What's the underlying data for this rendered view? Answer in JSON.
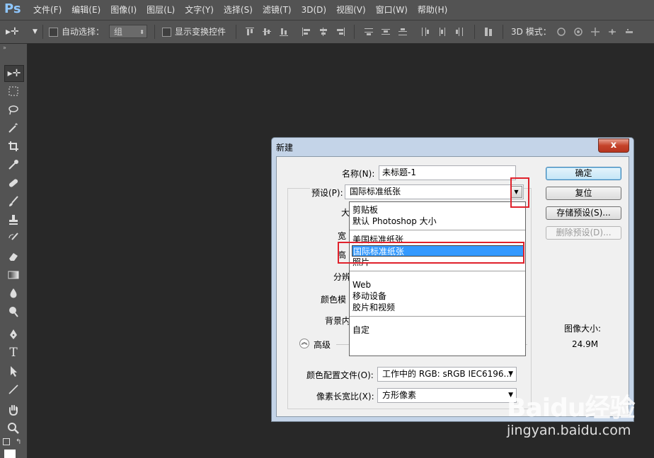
{
  "app": {
    "logo": "Ps"
  },
  "menu": [
    "文件(F)",
    "编辑(E)",
    "图像(I)",
    "图层(L)",
    "文字(Y)",
    "选择(S)",
    "滤镜(T)",
    "3D(D)",
    "视图(V)",
    "窗口(W)",
    "帮助(H)"
  ],
  "options": {
    "auto_select_label": "自动选择：",
    "auto_select_value": "组",
    "show_transform_label": "显示变换控件",
    "mode_3d_label": "3D 模式："
  },
  "tools": [
    "move-tool-icon",
    "marquee-tool-icon",
    "lasso-tool-icon",
    "magic-wand-icon",
    "crop-tool-icon",
    "eyedropper-icon",
    "healing-brush-icon",
    "brush-tool-icon",
    "clone-stamp-icon",
    "history-brush-icon",
    "eraser-icon",
    "gradient-tool-icon",
    "blur-tool-icon",
    "dodge-tool-icon",
    "pen-tool-icon",
    "type-tool-icon",
    "path-select-icon",
    "line-tool-icon",
    "hand-tool-icon",
    "zoom-tool-icon"
  ],
  "dialog": {
    "title": "新建",
    "close_glyph": "x",
    "name_label": "名称(N):",
    "name_value": "未标题-1",
    "preset_label": "预设(P):",
    "preset_value": "国际标准纸张",
    "partial_labels": {
      "size": "大",
      "width": "宽",
      "height": "高",
      "resolution": "分辨",
      "color_mode": "颜色模",
      "background": "背景内"
    },
    "advanced_label": "高级",
    "color_profile_label": "颜色配置文件(O):",
    "color_profile_value": "工作中的 RGB: sRGB IEC6196...",
    "pixel_aspect_label": "像素长宽比(X):",
    "pixel_aspect_value": "方形像素",
    "buttons": {
      "ok": "确定",
      "reset": "复位",
      "save_preset": "存储预设(S)...",
      "delete_preset": "删除预设(D)..."
    },
    "image_size_label": "图像大小:",
    "image_size_value": "24.9M",
    "dropdown_items": [
      "剪贴板",
      "默认 Photoshop 大小",
      "美国标准纸张",
      "国际标准纸张",
      "照片",
      "Web",
      "移动设备",
      "胶片和视频",
      "自定"
    ]
  },
  "watermark": {
    "logo": "Baidu经验",
    "site": "jingyan.baidu.com"
  }
}
